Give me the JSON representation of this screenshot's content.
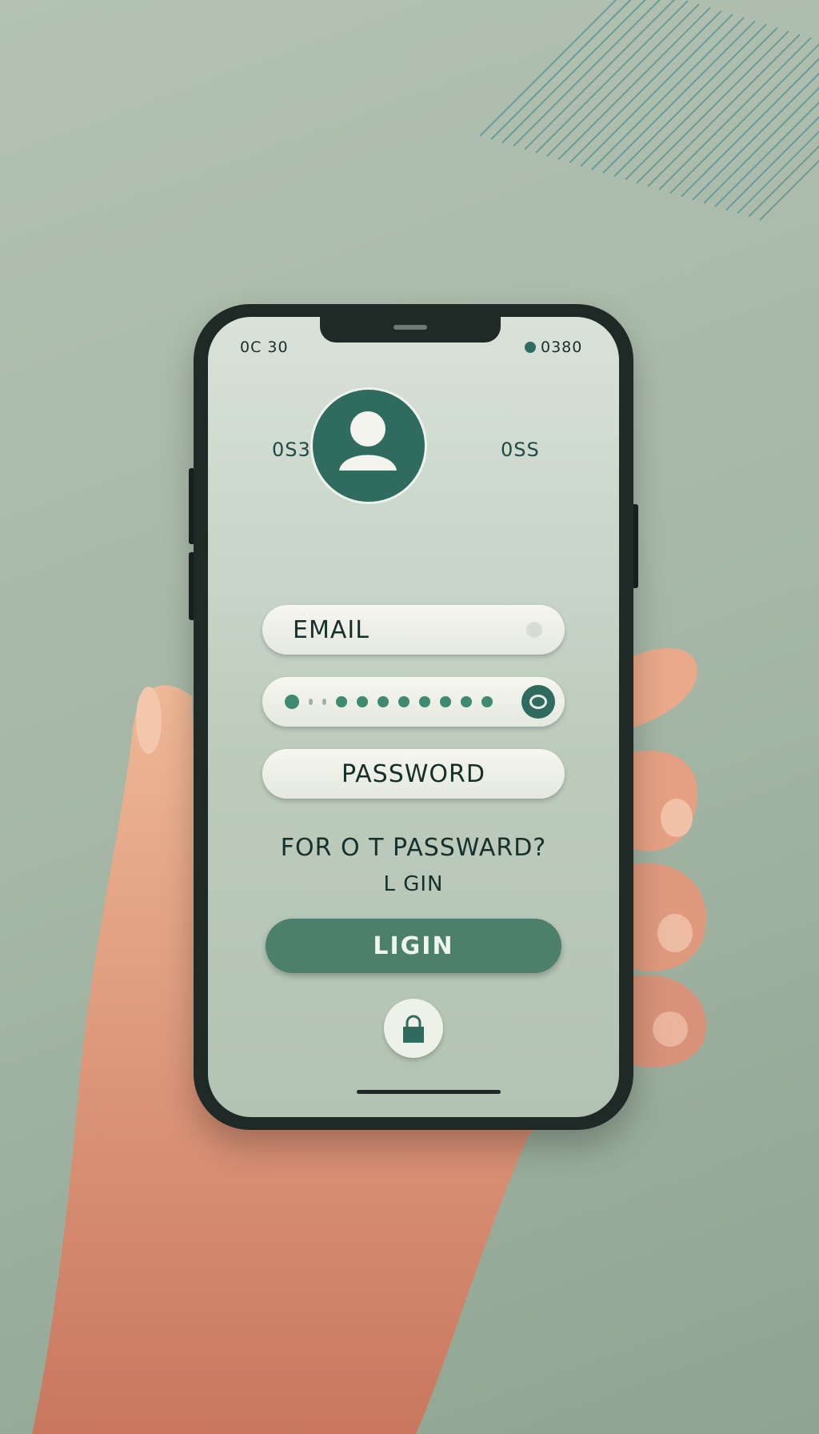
{
  "status_bar": {
    "time": "0C 30",
    "right": "0380",
    "indicator_icon": "battery-icon"
  },
  "header": {
    "left_label": "0S3",
    "right_label": "0SS",
    "avatar_icon": "user-icon"
  },
  "form": {
    "email_placeholder": "EMAIL",
    "password_dots_count": 11,
    "eye_icon": "eye-icon",
    "password_placeholder": "PASSWORD",
    "forgot_link": "FOR O T PASSWARD?",
    "login_link": "L GIN",
    "login_button": "LIGIN",
    "lock_icon": "lock-icon"
  },
  "colors": {
    "accent": "#2f6b5e",
    "button": "#4c7f6c",
    "background": "#a9b9a9",
    "skin": "#e9a184"
  }
}
